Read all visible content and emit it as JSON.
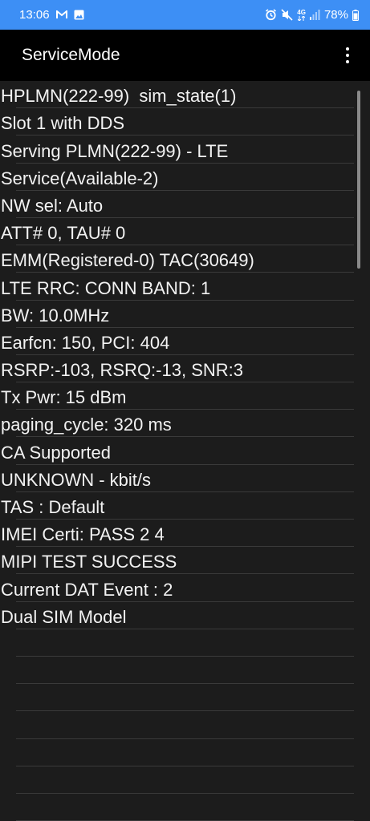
{
  "status_bar": {
    "time": "13:06",
    "network_type": "4G",
    "battery": "78%",
    "icons": [
      "gmail-icon",
      "gallery-icon",
      "alarm-icon",
      "mute-icon",
      "signal-icon",
      "battery-icon"
    ]
  },
  "app_bar": {
    "title": "ServiceMode",
    "menu_icon": "more-vertical-icon"
  },
  "rows": [
    "HPLMN(222-99)  sim_state(1)",
    "Slot 1 with DDS",
    "Serving PLMN(222-99) - LTE",
    "Service(Available-2)",
    "NW sel: Auto",
    "ATT# 0, TAU# 0",
    "EMM(Registered-0) TAC(30649)",
    "LTE RRC: CONN BAND: 1",
    "BW: 10.0MHz",
    "Earfcn: 150, PCI: 404",
    "RSRP:-103, RSRQ:-13, SNR:3",
    "Tx Pwr: 15 dBm",
    "paging_cycle: 320 ms",
    "CA Supported",
    "UNKNOWN - kbit/s",
    "TAS : Default",
    "IMEI Certi: PASS 2 4",
    "MIPI TEST SUCCESS",
    "Current DAT Event : 2",
    "Dual SIM Model",
    "",
    "",
    "",
    "",
    "",
    "",
    ""
  ],
  "colors": {
    "status_bar": "#3d8ff5",
    "app_bar": "#000000",
    "content_bg": "#1c1c1c",
    "divider": "#3a3a3a",
    "text": "#f2f2f2"
  }
}
